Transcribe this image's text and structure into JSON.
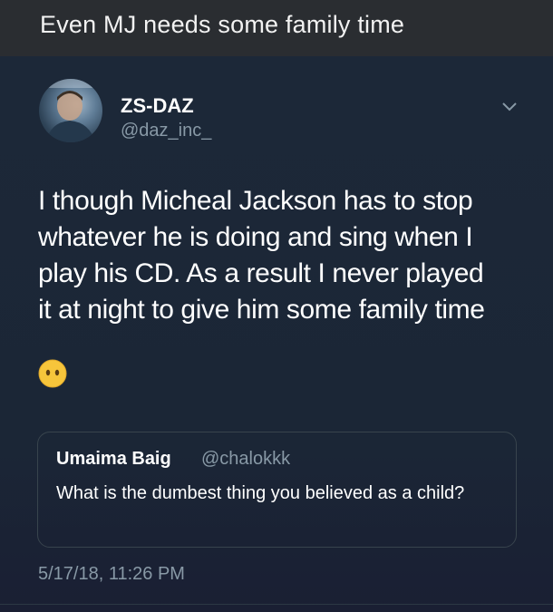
{
  "caption": "Even MJ needs some family time",
  "tweet": {
    "author": {
      "name": "ZS-DAZ",
      "handle": "@daz_inc_",
      "avatar_icon": "profile-photo"
    },
    "menu_icon": "chevron-down-icon",
    "text_lines": [
      "I though Micheal Jackson has to stop",
      "whatever he is doing and sing when I",
      "play his CD. As a result I never played",
      "it at night to give him some family time"
    ],
    "emoji": "face-without-mouth",
    "quoted_tweet": {
      "name": "Umaima Baig",
      "handle": "@chalokkk",
      "text": "What is the dumbest thing you believed as a child?"
    },
    "timestamp": "5/17/18, 11:26 PM"
  },
  "colors": {
    "caption_bar": "#2a2d31",
    "tweet_background": "#1c2838",
    "secondary_text": "#8899a6",
    "border": "#38444d",
    "emoji_yellow": "#f7c53b"
  }
}
